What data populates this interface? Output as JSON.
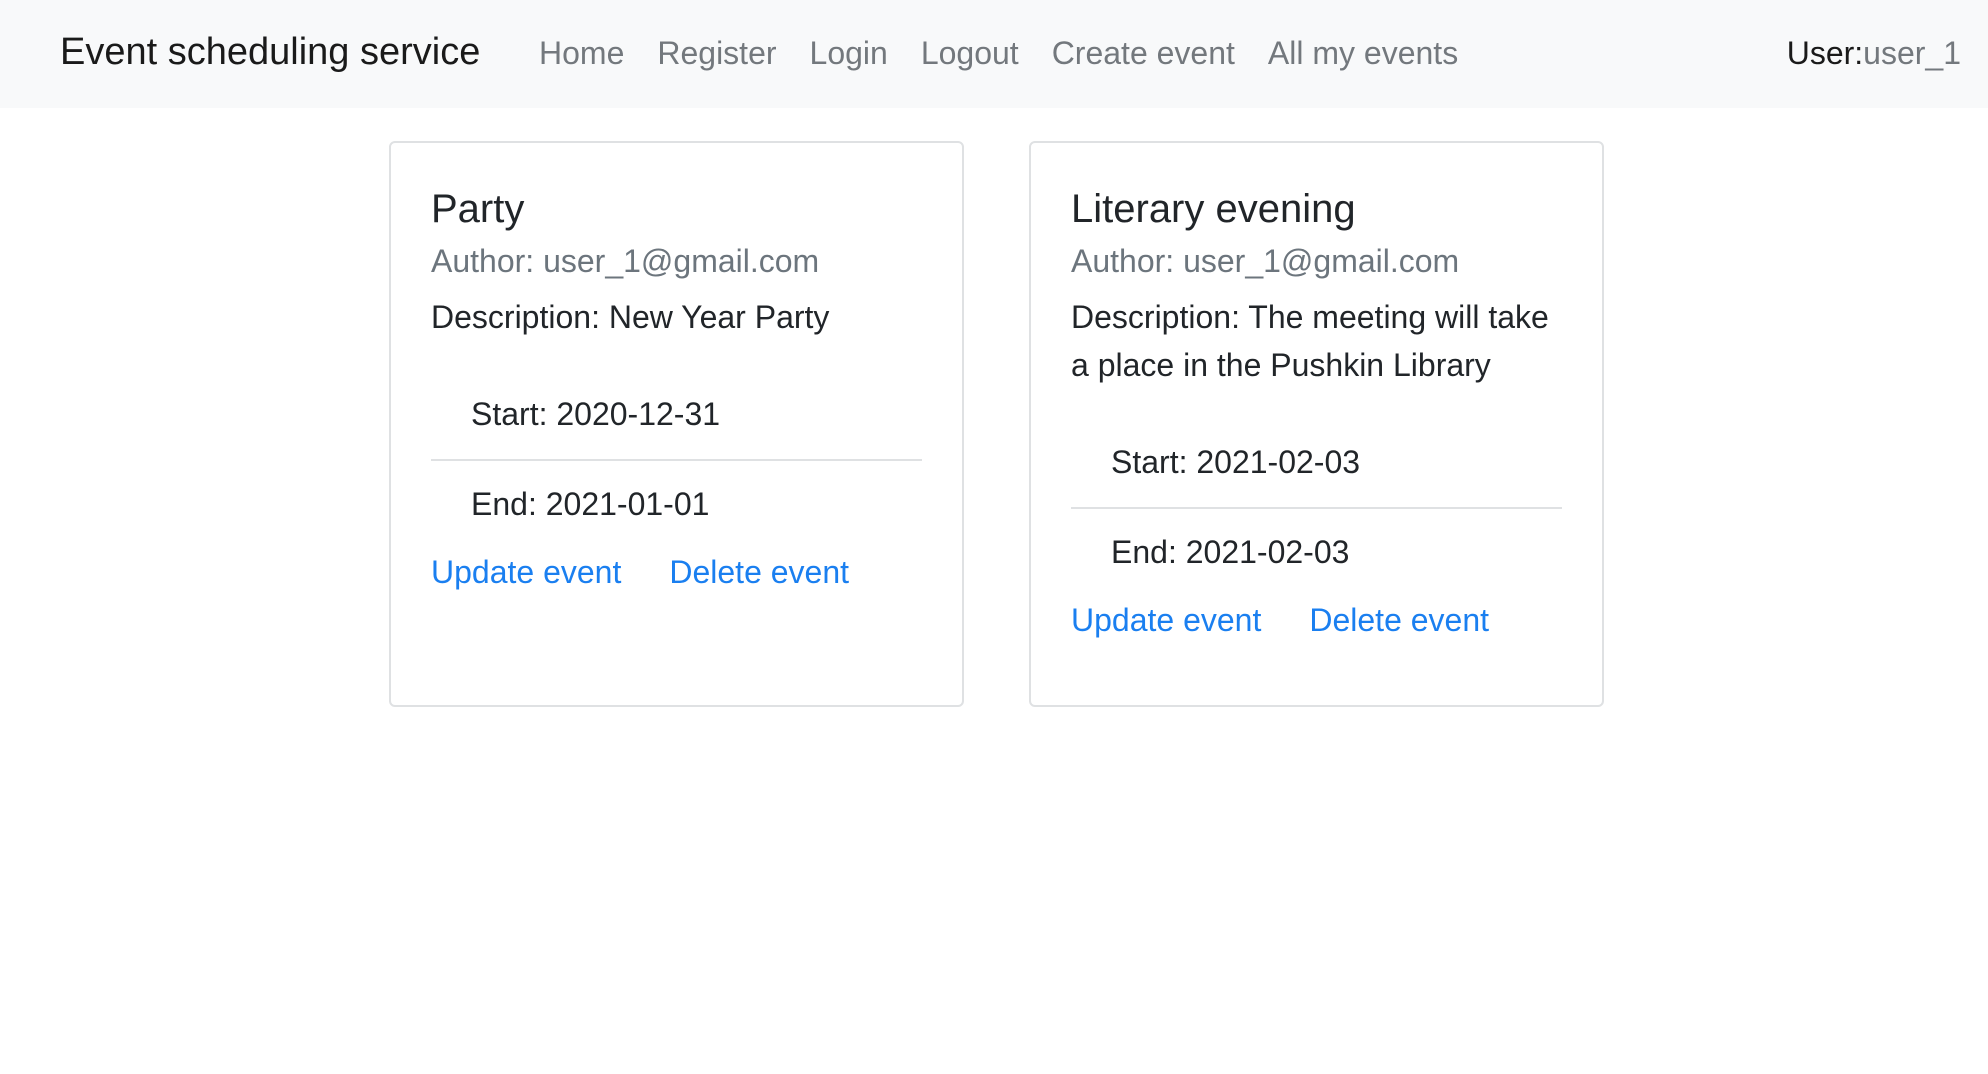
{
  "navbar": {
    "brand": "Event scheduling service",
    "links": [
      "Home",
      "Register",
      "Login",
      "Logout",
      "Create event",
      "All my events"
    ],
    "user_label": "User:",
    "user_name": "user_1"
  },
  "events": [
    {
      "title": "Party",
      "author": "Author: user_1@gmail.com",
      "description": "Description: New Year Party",
      "start": "Start: 2020-12-31",
      "end": "End: 2021-01-01",
      "update_label": "Update event",
      "delete_label": "Delete event"
    },
    {
      "title": "Literary evening",
      "author": "Author: user_1@gmail.com",
      "description": "Description: The meeting will take a place in the Pushkin Library",
      "start": "Start: 2021-02-03",
      "end": "End: 2021-02-03",
      "update_label": "Update event",
      "delete_label": "Delete event"
    }
  ],
  "colors": {
    "navbar_bg": "#f8f9fa",
    "link": "#1a7ff0",
    "muted": "#6c757d"
  }
}
